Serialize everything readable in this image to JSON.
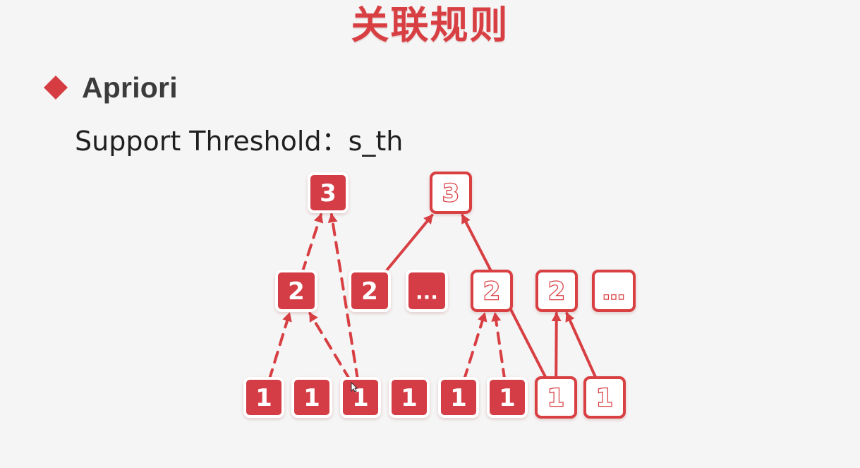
{
  "slide": {
    "title": "关联规则",
    "bullet_label": "Apriori",
    "support_label": "Support Threshold：s_th"
  },
  "colors": {
    "accent": "#d83f43",
    "filled_node": "#d43d45",
    "outline_node_fill": "#ffffff",
    "text_dark": "#3b3b3b",
    "background": "#f5f5f5"
  },
  "diagram": {
    "nodes": [
      {
        "id": "top-left-3",
        "label": "3",
        "style": "filled"
      },
      {
        "id": "top-right-3",
        "label": "3",
        "style": "outline"
      },
      {
        "id": "mid-1",
        "label": "2",
        "style": "filled"
      },
      {
        "id": "mid-2",
        "label": "2",
        "style": "filled"
      },
      {
        "id": "mid-3",
        "label": "...",
        "style": "filled"
      },
      {
        "id": "mid-4",
        "label": "2",
        "style": "outline"
      },
      {
        "id": "mid-5",
        "label": "2",
        "style": "outline"
      },
      {
        "id": "mid-6",
        "label": "...",
        "style": "outline"
      },
      {
        "id": "bot-1",
        "label": "1",
        "style": "filled"
      },
      {
        "id": "bot-2",
        "label": "1",
        "style": "filled"
      },
      {
        "id": "bot-3",
        "label": "1",
        "style": "filled"
      },
      {
        "id": "bot-4",
        "label": "1",
        "style": "filled"
      },
      {
        "id": "bot-5",
        "label": "1",
        "style": "filled"
      },
      {
        "id": "bot-6",
        "label": "1",
        "style": "filled"
      },
      {
        "id": "bot-7",
        "label": "1",
        "style": "outline"
      },
      {
        "id": "bot-8",
        "label": "1",
        "style": "outline"
      }
    ],
    "edges": [
      {
        "from": "bot-1",
        "to": "mid-1",
        "style": "dashed"
      },
      {
        "from": "bot-3",
        "to": "mid-1",
        "style": "dashed"
      },
      {
        "from": "mid-1",
        "to": "top-left-3",
        "style": "dashed"
      },
      {
        "from": "bot-3",
        "to": "top-left-3",
        "style": "dashed"
      },
      {
        "from": "mid-2",
        "to": "top-right-3",
        "style": "solid"
      },
      {
        "from": "bot-7",
        "to": "top-right-3",
        "style": "solid"
      },
      {
        "from": "bot-5",
        "to": "mid-4",
        "style": "dashed"
      },
      {
        "from": "bot-6",
        "to": "mid-4",
        "style": "dashed"
      },
      {
        "from": "bot-7",
        "to": "mid-5",
        "style": "solid"
      },
      {
        "from": "bot-8",
        "to": "mid-5",
        "style": "solid"
      }
    ]
  }
}
